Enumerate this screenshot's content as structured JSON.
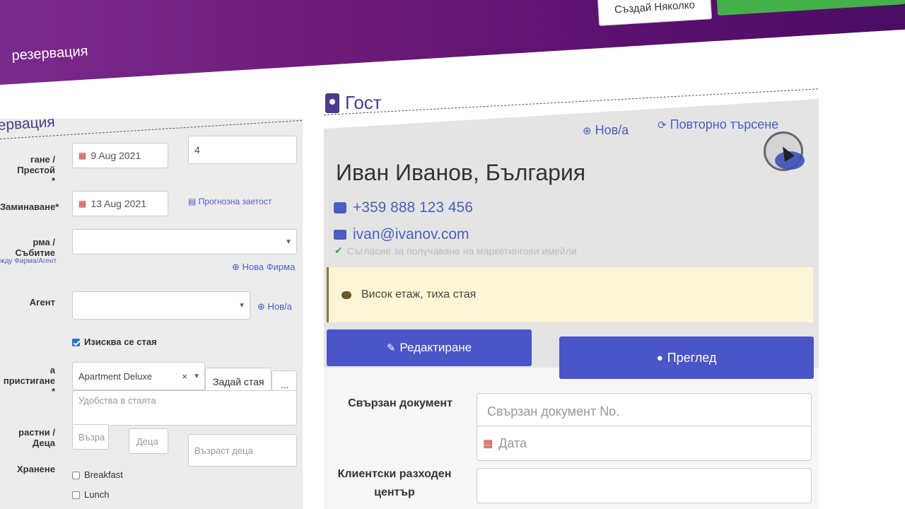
{
  "header": {
    "title": "резервация",
    "create_multi_label": "Създай Няколко"
  },
  "left_form": {
    "section_title": "ервация",
    "arrival_label": "гане / Престой",
    "arrival_required": "*",
    "arrival_date": "9 Aug 2021",
    "nights": "4",
    "departure_label": "Заминаване*",
    "departure_date": "13 Aug 2021",
    "forecast_link": "Прогнозна заетост",
    "company_label": "рма / Събитие",
    "company_sublink": "жду Фирма/Агент",
    "new_company_link": "Нова Фирма",
    "agent_label": "Агент",
    "new_agent_link": "Нов/а",
    "room_required_label": "Изисква се стая",
    "arrival_room_label": "а пристигане *",
    "room_type_value": "Apartment Deluxe",
    "room_type_clear": "×",
    "set_room_label": "Задай стая",
    "more_label": "...",
    "amenities_placeholder": "Удобства в стаята",
    "adults_children_label": "растни / Деца",
    "adults_placeholder": "Възра",
    "children_placeholder": "Деца",
    "children_age_placeholder": "Възраст деца",
    "meals_label": "Хранене",
    "meals": [
      "Breakfast",
      "Lunch"
    ]
  },
  "guest": {
    "section_title": "Гост",
    "new_link": "Нов/а",
    "research_link": "Повторно търсене",
    "name": "Иван Иванов, България",
    "phone": "+359 888 123 456",
    "email": "ivan@ivanov.com",
    "consent": "Съгласие за получаване на маркетингови имейли",
    "note": "Висок етаж, тиха стая",
    "edit_button": "Редактиране",
    "view_button": "Преглед",
    "linked_doc_label": "Свързан документ",
    "linked_doc_placeholder": "Свързан документ No.",
    "date_placeholder": "Дата",
    "cost_center_label": "Клиентски разходен център"
  },
  "colors": {
    "header_purple": "#6b1a78",
    "accent_blue": "#4a55c8",
    "link_blue": "#4a5fc1",
    "title_purple": "#4b3b8e",
    "note_yellow": "#fcf6d6"
  }
}
